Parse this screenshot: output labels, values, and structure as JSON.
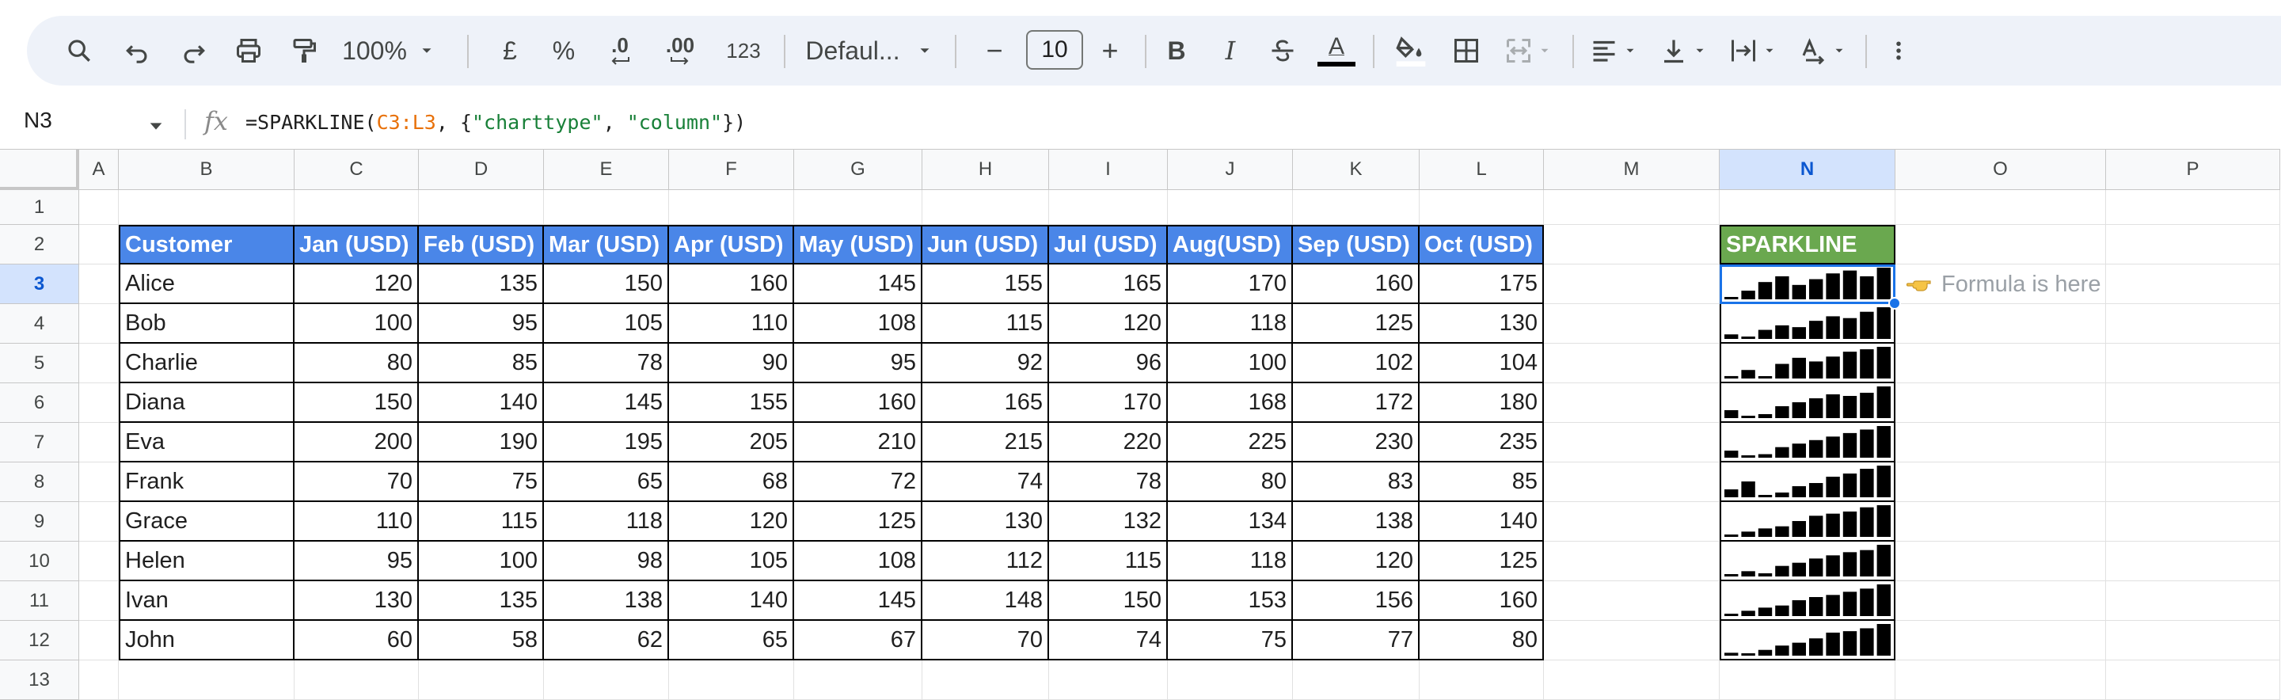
{
  "toolbar": {
    "zoom": "100%",
    "currency": "£",
    "percent": "%",
    "dec_decrease": ".0",
    "dec_increase": ".00",
    "number_format": "123",
    "font": "Defaul...",
    "font_size": "10",
    "minus": "−",
    "plus": "+",
    "bold": "B",
    "italic": "I",
    "text_color_letter": "A",
    "text_color": "#000000",
    "highlight_color": "#ffffff"
  },
  "formula_bar": {
    "cell_ref": "N3",
    "formula_parts": [
      "=SPARKLINE(",
      "C3:L3",
      ", {",
      "\"charttype\"",
      ", ",
      "\"column\"",
      "})"
    ]
  },
  "columns": [
    "A",
    "B",
    "C",
    "D",
    "E",
    "F",
    "G",
    "H",
    "I",
    "J",
    "K",
    "L",
    "M",
    "N",
    "O",
    "P"
  ],
  "selected_column": "N",
  "rows": [
    "1",
    "2",
    "3",
    "4",
    "5",
    "6",
    "7",
    "8",
    "9",
    "10",
    "11",
    "12",
    "13"
  ],
  "selected_row": "3",
  "table": {
    "headers": [
      "Customer",
      "Jan (USD)",
      "Feb (USD)",
      "Mar (USD)",
      "Apr (USD)",
      "May (USD)",
      "Jun (USD)",
      "Jul (USD)",
      "Aug(USD)",
      "Sep (USD)",
      "Oct (USD)"
    ],
    "data": [
      {
        "name": "Alice",
        "values": [
          120,
          135,
          150,
          160,
          145,
          155,
          165,
          170,
          160,
          175
        ]
      },
      {
        "name": "Bob",
        "values": [
          100,
          95,
          105,
          110,
          108,
          115,
          120,
          118,
          125,
          130
        ]
      },
      {
        "name": "Charlie",
        "values": [
          80,
          85,
          78,
          90,
          95,
          92,
          96,
          100,
          102,
          104
        ]
      },
      {
        "name": "Diana",
        "values": [
          150,
          140,
          145,
          155,
          160,
          165,
          170,
          168,
          172,
          180
        ]
      },
      {
        "name": "Eva",
        "values": [
          200,
          190,
          195,
          205,
          210,
          215,
          220,
          225,
          230,
          235
        ]
      },
      {
        "name": "Frank",
        "values": [
          70,
          75,
          65,
          68,
          72,
          74,
          78,
          80,
          83,
          85
        ]
      },
      {
        "name": "Grace",
        "values": [
          110,
          115,
          118,
          120,
          125,
          130,
          132,
          134,
          138,
          140
        ]
      },
      {
        "name": "Helen",
        "values": [
          95,
          100,
          98,
          105,
          108,
          112,
          115,
          118,
          120,
          125
        ]
      },
      {
        "name": "Ivan",
        "values": [
          130,
          135,
          138,
          140,
          145,
          148,
          150,
          153,
          156,
          160
        ]
      },
      {
        "name": "John",
        "values": [
          60,
          58,
          62,
          65,
          67,
          70,
          74,
          75,
          77,
          80
        ]
      }
    ]
  },
  "sparkline_header": "SPARKLINE",
  "annotation": "Formula is here",
  "colors": {
    "header_blue": "#4a86e8",
    "sparkline_green": "#6aa84f",
    "selection_blue": "#1a73e8",
    "formula_range": "#e8710a",
    "formula_string": "#188038"
  }
}
